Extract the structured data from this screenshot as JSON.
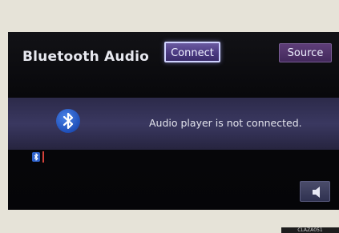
{
  "screen": {
    "title": "Bluetooth Audio",
    "buttons": {
      "connect": "Connect",
      "source": "Source"
    },
    "status_message": "Audio player is not connected.",
    "icons": {
      "bluetooth_large": "bluetooth-icon",
      "bluetooth_small": "bluetooth-icon",
      "signal": "signal-strength-icon",
      "speaker": "speaker-volume-icon"
    },
    "colors": {
      "accent": "#4b3a82",
      "bluetooth": "#1f4fb8",
      "signal": "#d5423a"
    }
  },
  "footer": {
    "tag": "CLAZA051"
  }
}
